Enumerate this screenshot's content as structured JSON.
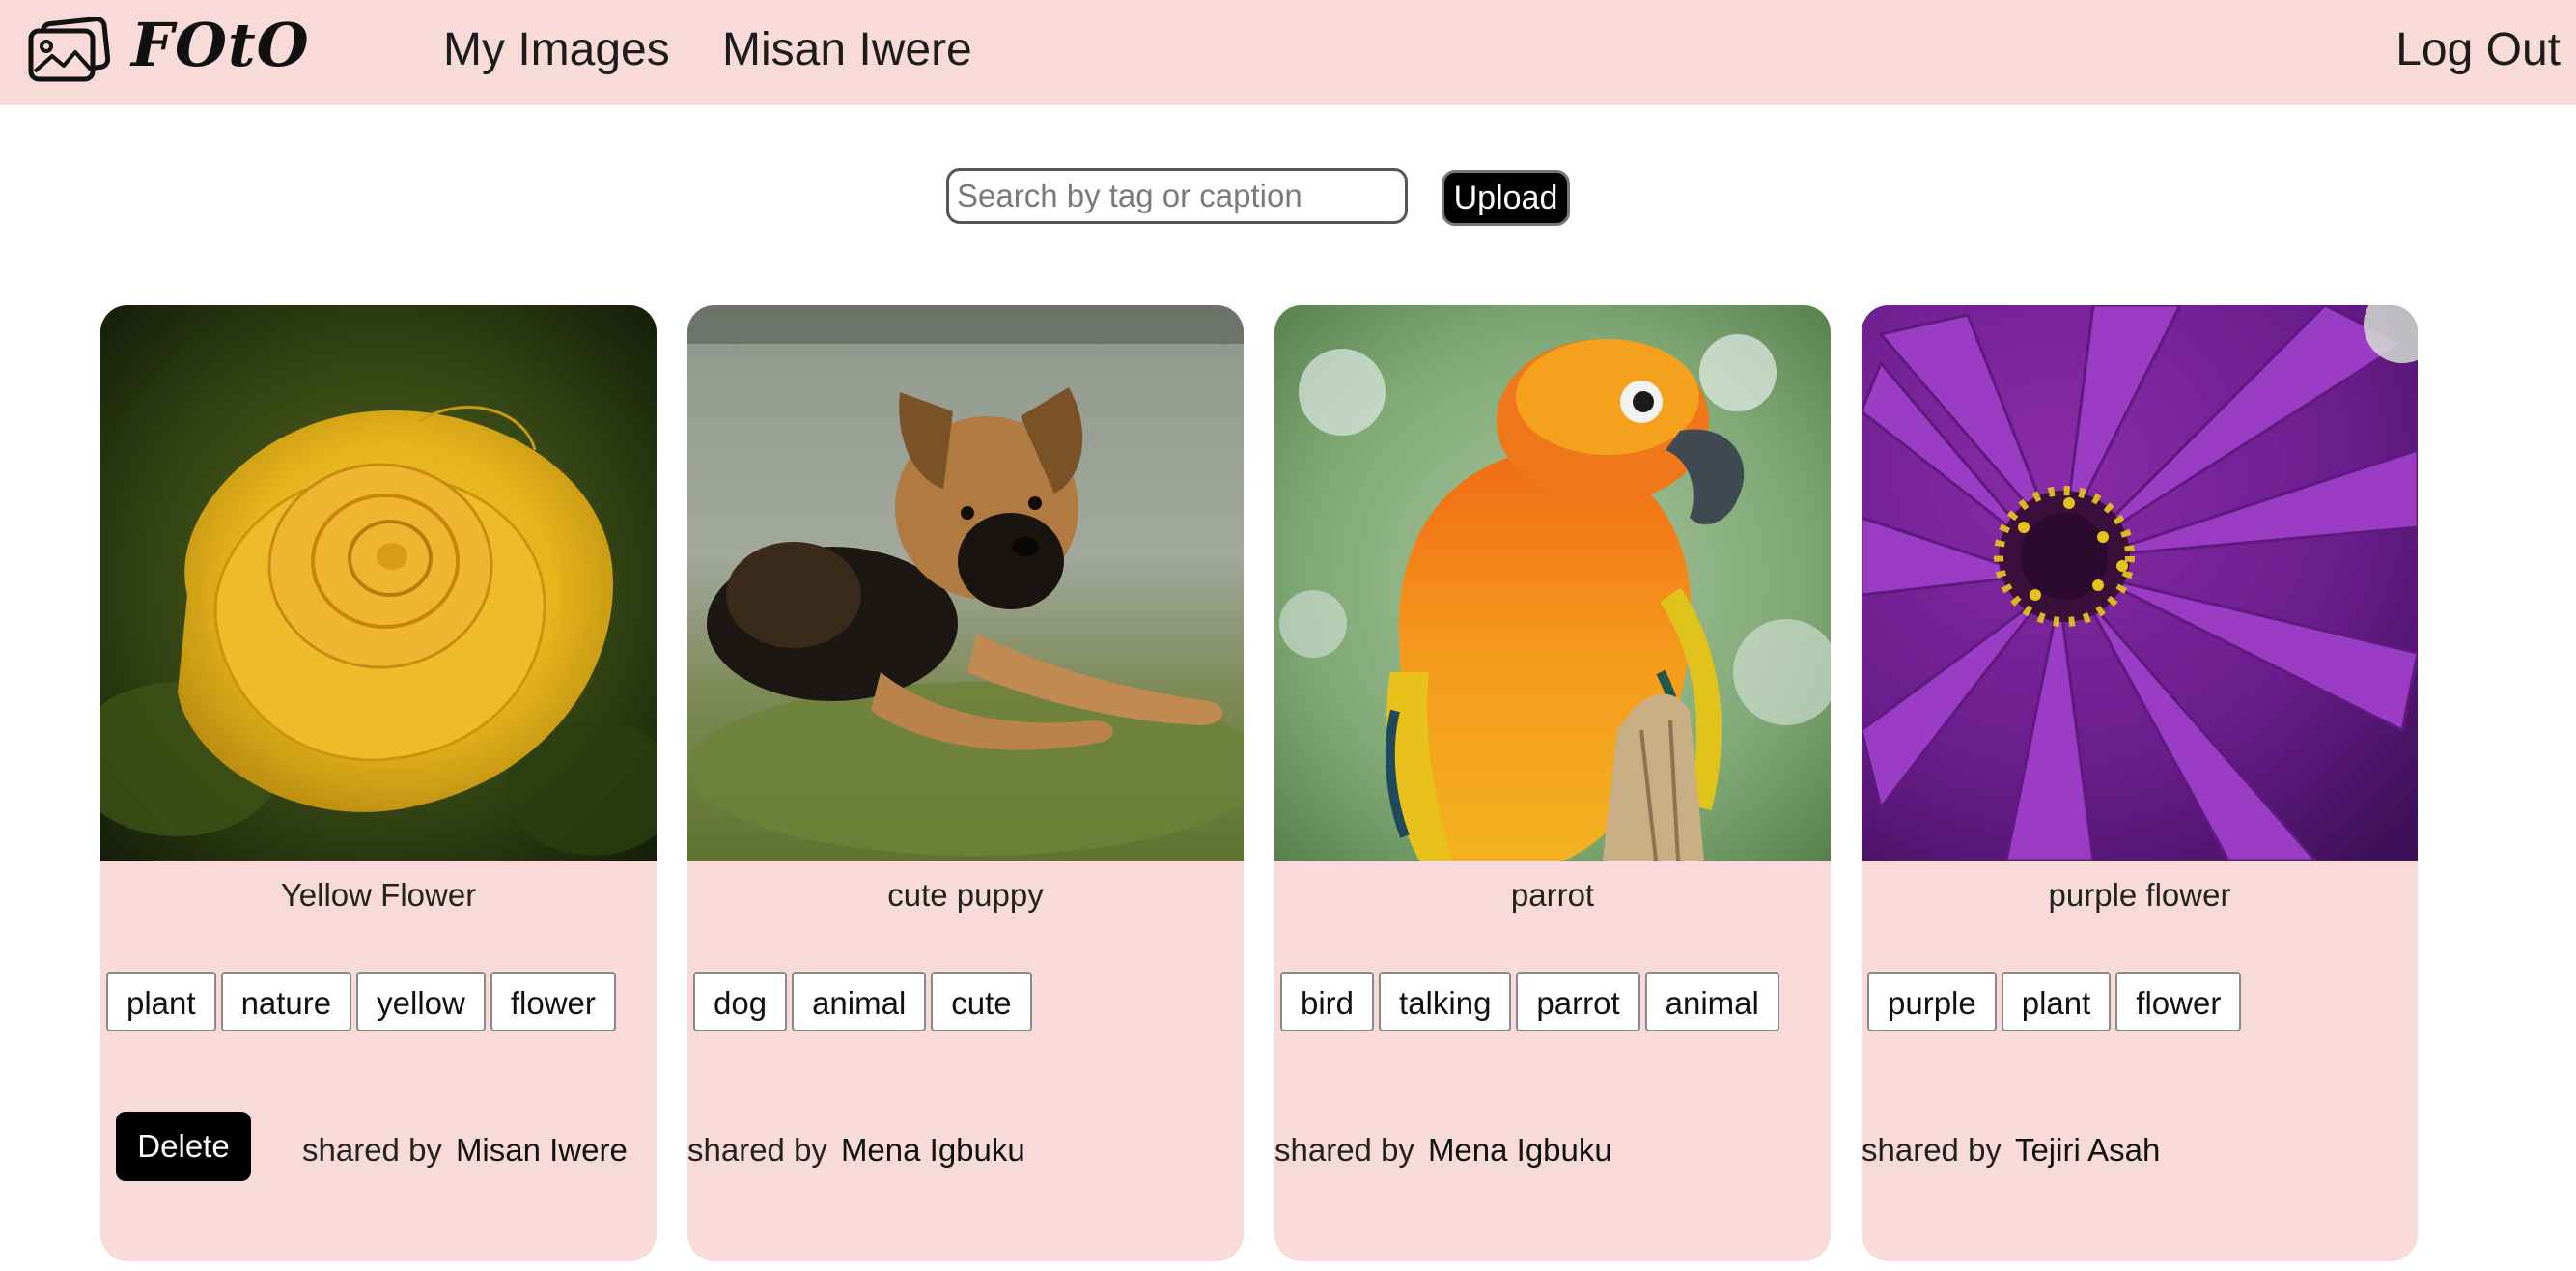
{
  "header": {
    "brand": "FOtO",
    "nav": {
      "my_images": "My Images",
      "user_name": "Misan Iwere",
      "logout": "Log Out"
    },
    "background_color": "#f8dbd9"
  },
  "toolbar": {
    "search_placeholder": "Search by tag or caption",
    "search_value": "",
    "upload_label": "Upload"
  },
  "cards": [
    {
      "caption": "Yellow Flower",
      "tags": [
        "plant",
        "nature",
        "yellow",
        "flower"
      ],
      "delete_label": "Delete",
      "shared_by_label": "shared by",
      "owner": "Misan Iwere",
      "image_subject": "yellow-rose"
    },
    {
      "caption": "cute puppy",
      "tags": [
        "dog",
        "animal",
        "cute"
      ],
      "shared_by_label": "shared by",
      "owner": "Mena Igbuku",
      "image_subject": "german-shepherd-puppy"
    },
    {
      "caption": "parrot",
      "tags": [
        "bird",
        "talking",
        "parrot",
        "animal"
      ],
      "shared_by_label": "shared by",
      "owner": "Mena Igbuku",
      "image_subject": "sun-conure-parrot"
    },
    {
      "caption": "purple flower",
      "tags": [
        "purple",
        "plant",
        "flower"
      ],
      "shared_by_label": "shared by",
      "owner": "Tejiri Asah",
      "image_subject": "purple-daisy"
    }
  ],
  "colors": {
    "accent_pink": "#f8dbd9",
    "button_black": "#000000"
  }
}
